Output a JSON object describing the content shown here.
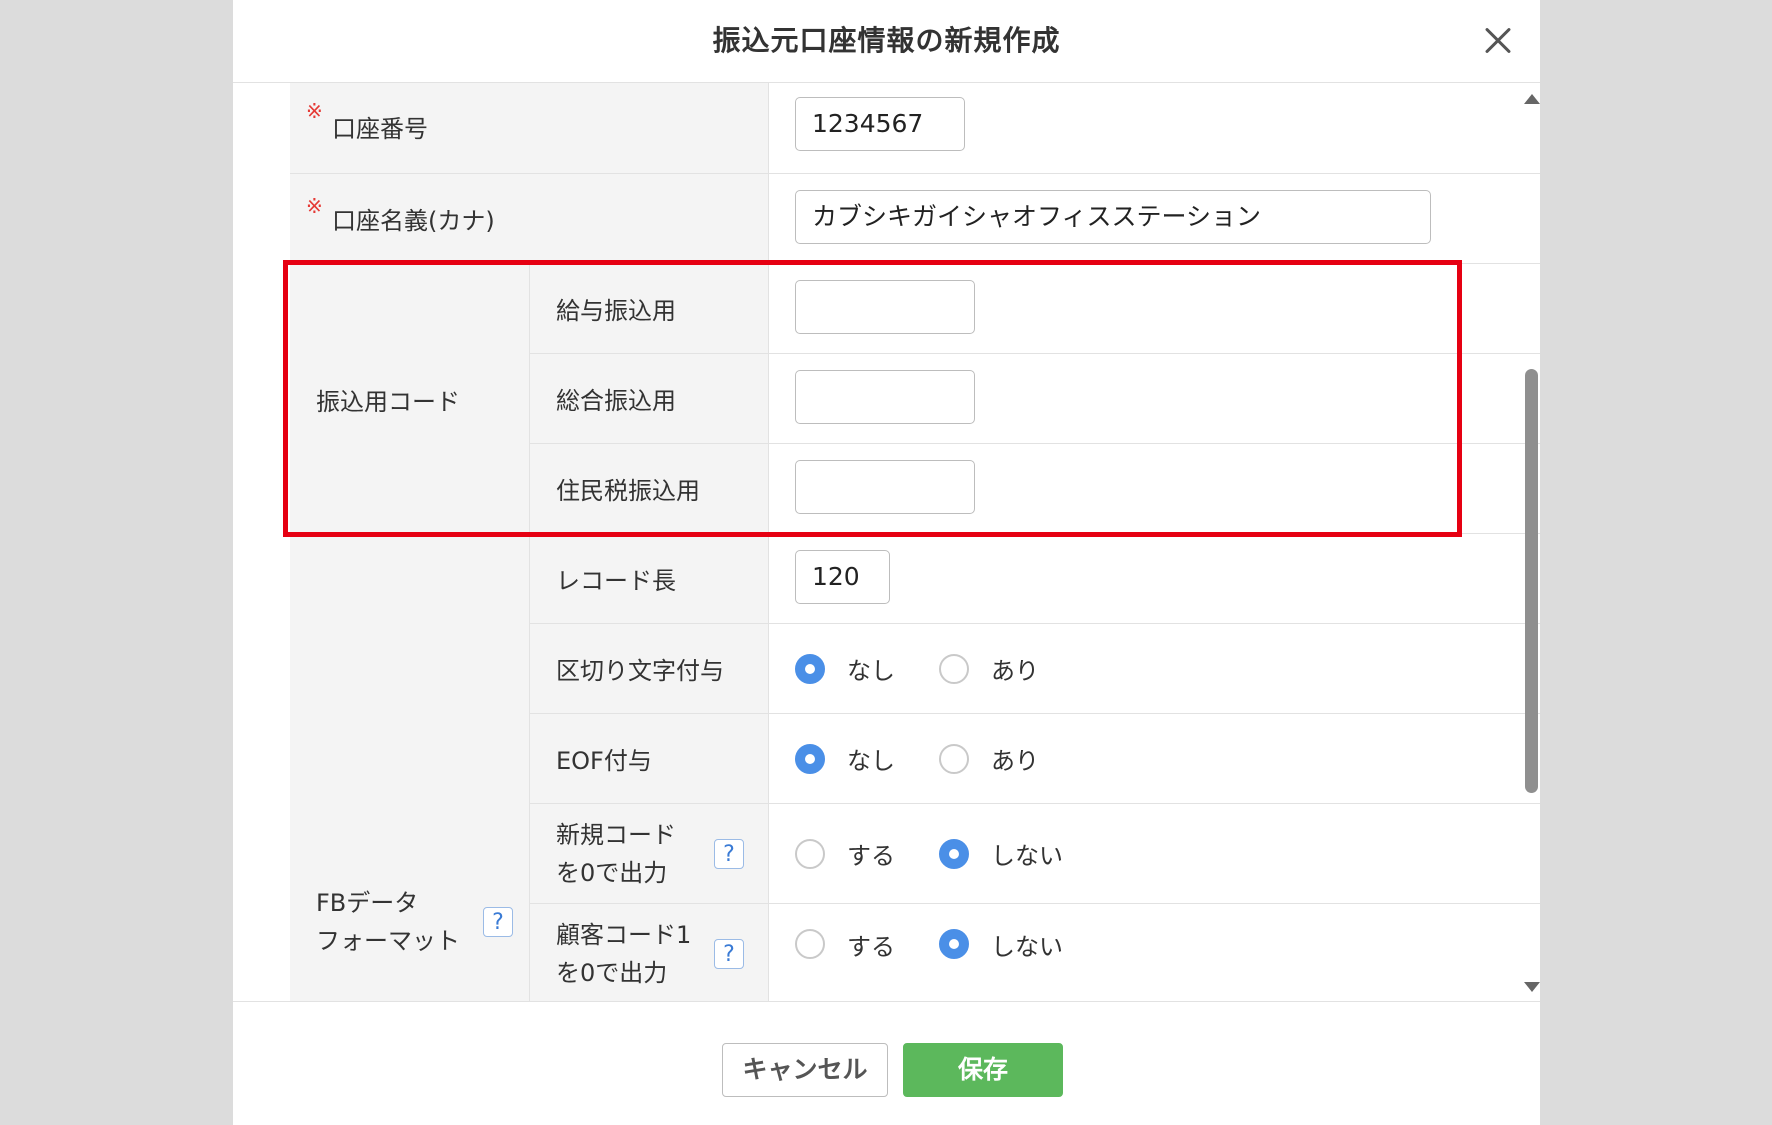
{
  "modal": {
    "title": "振込元口座情報の新規作成"
  },
  "form": {
    "required_mark": "※",
    "account_number": {
      "label": "口座番号",
      "value": "1234567"
    },
    "account_name": {
      "label": "口座名義(カナ)",
      "value": "カブシキガイシャオフィスステーション"
    },
    "transfer_code": {
      "label": "振込用コード",
      "salary": {
        "label": "給与振込用",
        "value": ""
      },
      "general": {
        "label": "総合振込用",
        "value": ""
      },
      "resident_tax": {
        "label": "住民税振込用",
        "value": ""
      }
    },
    "fb_format": {
      "label_line1": "FBデータ",
      "label_line2": "フォーマット",
      "record_length": {
        "label": "レコード長",
        "value": "120"
      },
      "delimiter": {
        "label": "区切り文字付与",
        "options": [
          "なし",
          "あり"
        ],
        "selected": "なし"
      },
      "eof": {
        "label": "EOF付与",
        "options": [
          "なし",
          "あり"
        ],
        "selected": "なし"
      },
      "new_code_zero": {
        "label_line1": "新規コード",
        "label_line2": "を0で出力",
        "options": [
          "する",
          "しない"
        ],
        "selected": "しない"
      },
      "customer_code_zero": {
        "label_line1": "顧客コード1",
        "label_line2": "を0で出力",
        "options": [
          "する",
          "しない"
        ],
        "selected": "しない"
      }
    }
  },
  "help_icon": "?",
  "footer": {
    "cancel_label": "キャンセル",
    "save_label": "保存"
  },
  "colors": {
    "highlight": "#e60012",
    "save_button": "#5cb85c",
    "radio_selected": "#4a8fe7",
    "required": "#e53935"
  }
}
